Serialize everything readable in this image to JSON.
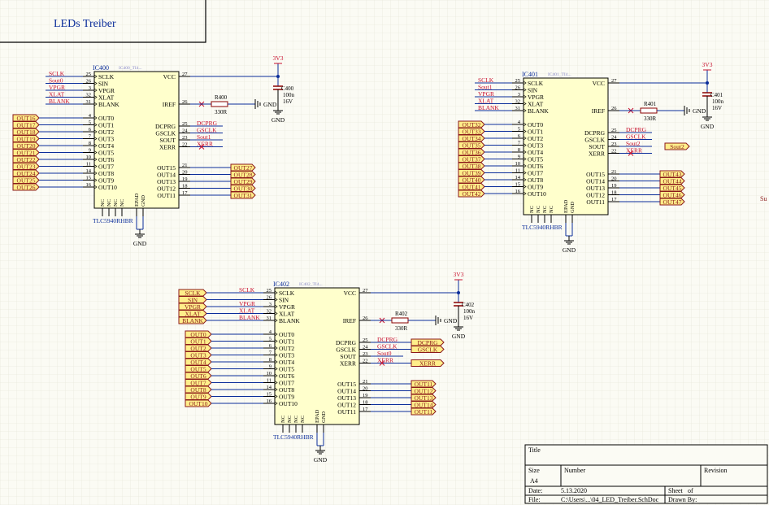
{
  "sheet": {
    "title_box": "LEDs Treiber",
    "stray_text": "Su"
  },
  "ics": [
    {
      "ref": "IC400",
      "param": "IC400_TI4...",
      "part": "TLC5940RHBR",
      "left_pins": [
        {
          "num": "25",
          "name": "SCLK"
        },
        {
          "num": "26",
          "name": "SIN"
        },
        {
          "num": "3",
          "name": "VPGR"
        },
        {
          "num": "32",
          "name": "XLAT"
        },
        {
          "num": "31",
          "name": "BLANK"
        },
        {
          "num": "4",
          "name": "OUT0"
        },
        {
          "num": "5",
          "name": "OUT1"
        },
        {
          "num": "6",
          "name": "OUT2"
        },
        {
          "num": "7",
          "name": "OUT3"
        },
        {
          "num": "8",
          "name": "OUT4"
        },
        {
          "num": "9",
          "name": "OUT5"
        },
        {
          "num": "10",
          "name": "OUT6"
        },
        {
          "num": "11",
          "name": "OUT7"
        },
        {
          "num": "14",
          "name": "OUT8"
        },
        {
          "num": "15",
          "name": "OUT9"
        },
        {
          "num": "16",
          "name": "OUT10"
        }
      ],
      "right_pins": [
        {
          "num": "27",
          "name": "VCC"
        },
        {
          "num": "26",
          "name": "IREF"
        },
        {
          "num": "25",
          "name": "DCPRG"
        },
        {
          "num": "24",
          "name": "GSCLK"
        },
        {
          "num": "23",
          "name": "SOUT"
        },
        {
          "num": "22",
          "name": "XERR"
        },
        {
          "num": "21",
          "name": "OUT15"
        },
        {
          "num": "20",
          "name": "OUT14"
        },
        {
          "num": "19",
          "name": "OUT13"
        },
        {
          "num": "18",
          "name": "OUT12"
        },
        {
          "num": "17",
          "name": "OUT11"
        }
      ],
      "bottom_pins": [
        "NC",
        "NC",
        "NC",
        "NC",
        "EPAD",
        "GND"
      ],
      "in_nets": [
        "SCLK",
        "Sout0",
        "VPGR",
        "XLAT",
        "BLANK"
      ],
      "right_nets": [
        "DCPRG",
        "GSCLK",
        "Sout1",
        "XERR"
      ],
      "left_ports": [
        "OUT16",
        "OUT17",
        "OUT18",
        "OUT19",
        "OUT20",
        "OUT21",
        "OUT22",
        "OUT23",
        "OUT24",
        "OUT25",
        "OUT26"
      ],
      "right_ports": [
        "OUT27",
        "OUT28",
        "OUT29",
        "OUT30",
        "OUT31"
      ],
      "vcc": "3V3",
      "res": {
        "ref": "R400",
        "val": "330R"
      },
      "cap": {
        "ref": "C400",
        "val1": "100n",
        "val2": "16V"
      },
      "gnd": "GND"
    },
    {
      "ref": "IC401",
      "param": "IC401_TI4...",
      "part": "TLC5940RHBR",
      "in_nets": [
        "SCLK",
        "Sout1",
        "VPGR",
        "XLAT",
        "BLANK"
      ],
      "right_nets": [
        "DCPRG",
        "GSCLK",
        "Sout2",
        "XERR"
      ],
      "out_port": "Sout2",
      "left_ports": [
        "OUT32",
        "OUT33",
        "OUT34",
        "OUT35",
        "OUT36",
        "OUT37",
        "OUT38",
        "OUT39",
        "OUT40",
        "OUT41",
        "OUT42"
      ],
      "right_ports": [
        "OUT43",
        "OUT44",
        "OUT45",
        "OUT46",
        "OUT47"
      ],
      "vcc": "3V3",
      "res": {
        "ref": "R401",
        "val": "330R"
      },
      "cap": {
        "ref": "C401",
        "val1": "100n",
        "val2": "16V"
      },
      "gnd": "GND"
    },
    {
      "ref": "IC402",
      "param": "IC402_TI4...",
      "part": "TLC5940RHBR",
      "in_ports": [
        "SCLK",
        "SIN",
        "VPGR",
        "XLAT",
        "BLANK"
      ],
      "in_nets": [
        "SCLK",
        "",
        "VPGR",
        "XLAT",
        "BLANK"
      ],
      "right_nets": [
        "DCPRG",
        "GSCLK",
        "Sout0",
        "XERR"
      ],
      "right_side_ports": [
        "DCPRG",
        "GSCLK",
        "XERR"
      ],
      "left_ports": [
        "OUT0",
        "OUT1",
        "OUT2",
        "OUT3",
        "OUT4",
        "OUT5",
        "OUT6",
        "OUT7",
        "OUT8",
        "OUT9",
        "OUT10"
      ],
      "right_ports": [
        "OUT11",
        "OUT12",
        "OUT13",
        "OUT14",
        "OUT11"
      ],
      "vcc": "3V3",
      "res": {
        "ref": "R402",
        "val": "330R"
      },
      "cap": {
        "ref": "C402",
        "val1": "100n",
        "val2": "16V"
      },
      "gnd": "GND"
    }
  ],
  "title_block": {
    "title_label": "Title",
    "size_label": "Size",
    "size_value": "A4",
    "number_label": "Number",
    "revision_label": "Revision",
    "date_label": "Date:",
    "date_value": "5.13.2020",
    "file_label": "File:",
    "file_value": "C:\\Users\\...\\04_LED_Treiber.SchDoc",
    "sheet_label": "Sheet",
    "of_label": "of",
    "drawn_label": "Drawn By:"
  },
  "colors": {
    "wire": "#0b2d9a",
    "red": "#c8102e",
    "port_fill": "#ffee8a",
    "port_stroke": "#8b1a1a",
    "ic_fill": "#ffffcc",
    "grid": "#e2e2d4",
    "component": "#8b0000"
  }
}
